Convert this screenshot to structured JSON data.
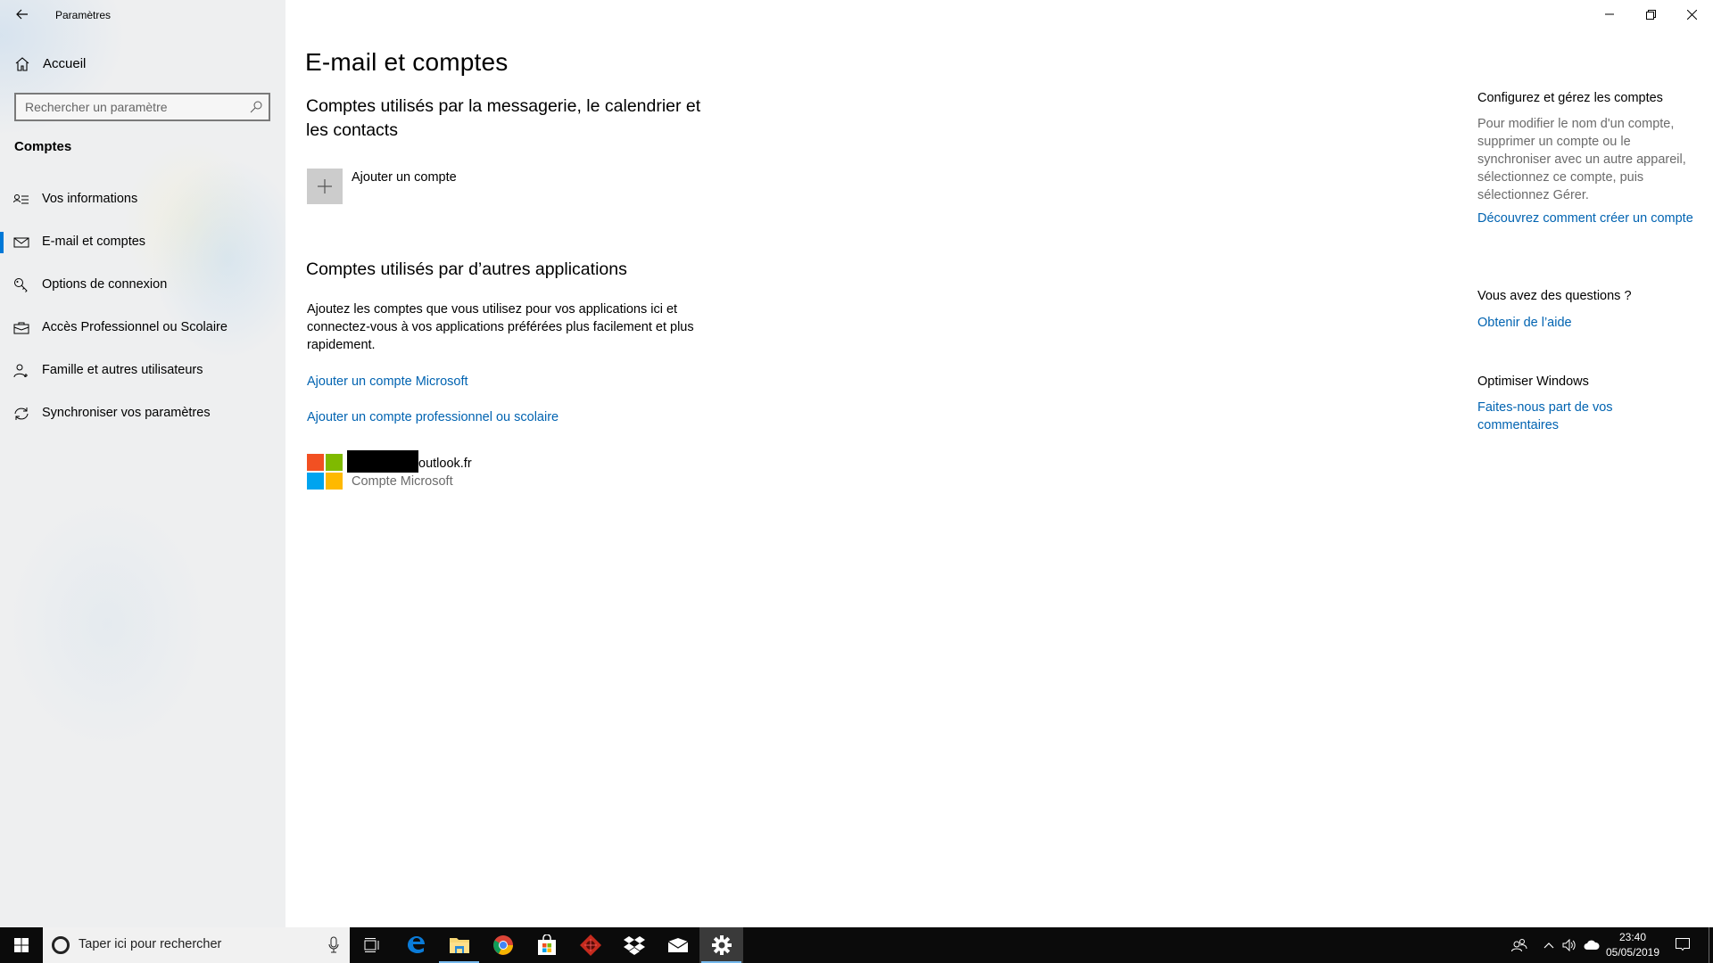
{
  "window": {
    "title": "Paramètres",
    "controls": {
      "minimize": "minimize-icon",
      "restore": "restore-icon",
      "close": "close-icon"
    }
  },
  "sidebar": {
    "home_label": "Accueil",
    "search_placeholder": "Rechercher un paramètre",
    "section_label": "Comptes",
    "items": [
      {
        "label": "Vos informations",
        "icon": "person-list-icon",
        "active": false
      },
      {
        "label": "E-mail et comptes",
        "icon": "mail-icon",
        "active": true
      },
      {
        "label": "Options de connexion",
        "icon": "key-icon",
        "active": false
      },
      {
        "label": "Accès Professionnel ou Scolaire",
        "icon": "briefcase-icon",
        "active": false
      },
      {
        "label": "Famille et autres utilisateurs",
        "icon": "add-person-icon",
        "active": false
      },
      {
        "label": "Synchroniser vos paramètres",
        "icon": "sync-icon",
        "active": false
      }
    ]
  },
  "main": {
    "title": "E-mail et comptes",
    "section1": {
      "heading": "Comptes utilisés par la messagerie, le calendrier et les contacts",
      "add_account_label": "Ajouter un compte"
    },
    "section2": {
      "heading": "Comptes utilisés par d’autres applications",
      "description": "Ajoutez les comptes que vous utilisez pour vos applications ici et connectez-vous à vos applications préférées plus facilement et plus rapidement.",
      "link_microsoft": "Ajouter un compte Microsoft",
      "link_work": "Ajouter un compte professionnel ou scolaire",
      "account": {
        "email_suffix": "outlook.fr",
        "type": "Compte Microsoft"
      }
    }
  },
  "side_panel": {
    "configure": {
      "heading": "Configurez et gérez les comptes",
      "text": "Pour modifier le nom d'un compte, supprimer un compte ou le synchroniser avec un autre appareil, sélectionnez ce compte, puis sélectionnez Gérer.",
      "link": "Découvrez comment créer un compte"
    },
    "questions": {
      "heading": "Vous avez des questions ?",
      "link": "Obtenir de l’aide"
    },
    "optimize": {
      "heading": "Optimiser Windows",
      "link": "Faites-nous part de vos commentaires"
    }
  },
  "taskbar": {
    "search_placeholder": "Taper ici pour rechercher",
    "apps": [
      "task-view",
      "edge",
      "file-explorer",
      "chrome",
      "store",
      "game-app",
      "dropbox",
      "mail",
      "settings"
    ],
    "time": "23:40",
    "date": "05/05/2019"
  },
  "colors": {
    "accent": "#0078d7",
    "link": "#0063b1",
    "taskbar": "#0b0b0b"
  }
}
